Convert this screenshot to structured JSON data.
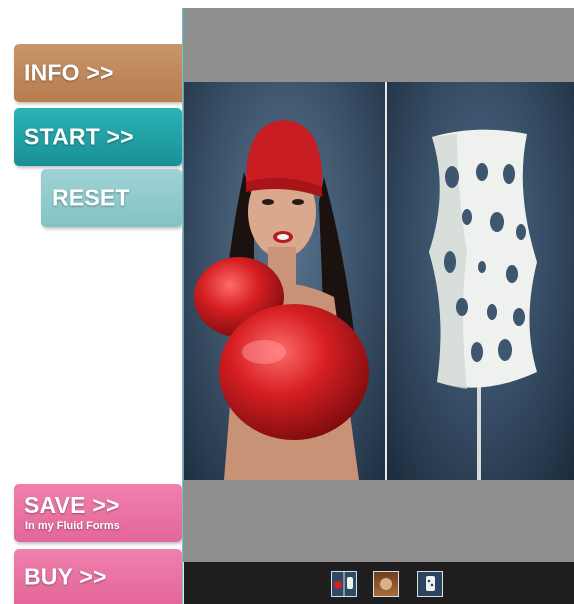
{
  "sidebar": {
    "info_label": "INFO >>",
    "start_label": "START >>",
    "reset_label": "RESET",
    "save_label": "SAVE >>",
    "save_sublabel": "In my Fluid Forms",
    "buy_label": "BUY >>"
  },
  "colors": {
    "info": "#b67d50",
    "start": "#1a9095",
    "reset": "#83c2c6",
    "save_buy": "#e3679a",
    "viewer_bg": "#8f8f8f",
    "thumbbar_bg": "#1e1e1e"
  },
  "thumbnails": [
    {
      "name": "boxer-lamp-thumbnail"
    },
    {
      "name": "brown-photo-thumbnail"
    },
    {
      "name": "lamp-thumbnail"
    }
  ]
}
